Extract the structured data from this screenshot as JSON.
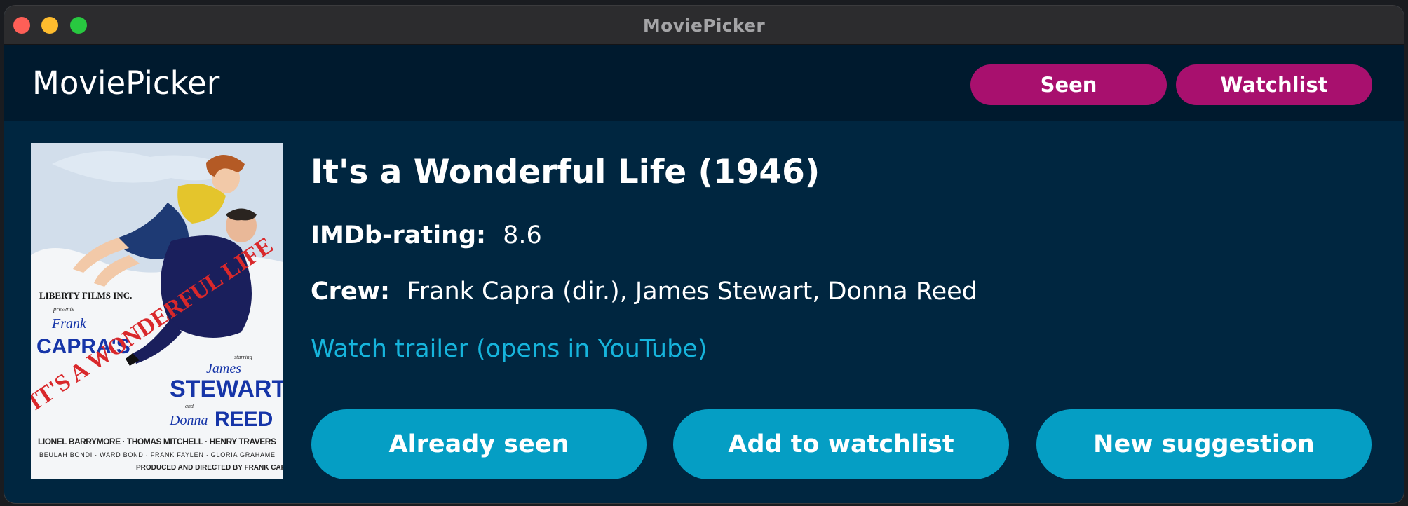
{
  "window": {
    "title": "MoviePicker"
  },
  "header": {
    "brand": "MoviePicker",
    "seen_label": "Seen",
    "watchlist_label": "Watchlist"
  },
  "movie": {
    "title": "It's a Wonderful Life (1946)",
    "rating_label": "IMDb-rating:",
    "rating_value": "8.6",
    "crew_label": "Crew:",
    "crew_value": "Frank Capra (dir.), James Stewart, Donna Reed",
    "trailer_link": "Watch trailer (opens in YouTube)"
  },
  "poster": {
    "studio": "LIBERTY FILMS INC.",
    "presents": "presents",
    "director_first": "Frank",
    "director_last": "CAPRA'S",
    "film_title": "IT'S A WONDERFUL LIFE",
    "starring": "starring",
    "star1_first": "James",
    "star1_last": "STEWART",
    "and": "and",
    "star2_first": "Donna",
    "star2_last": "REED",
    "cast_line1": "LIONEL BARRYMORE · THOMAS MITCHELL · HENRY TRAVERS",
    "cast_line2": "BEULAH BONDI · WARD BOND · FRANK FAYLEN · GLORIA GRAHAME",
    "credit_line": "PRODUCED AND DIRECTED BY FRANK CAPRA"
  },
  "actions": {
    "already_seen": "Already seen",
    "add_watchlist": "Add to watchlist",
    "new_suggestion": "New suggestion"
  },
  "colors": {
    "header_pill": "#a8106e",
    "action_button": "#059ec4",
    "link": "#16b4dc",
    "background": "#002640",
    "header": "#001a2e"
  }
}
